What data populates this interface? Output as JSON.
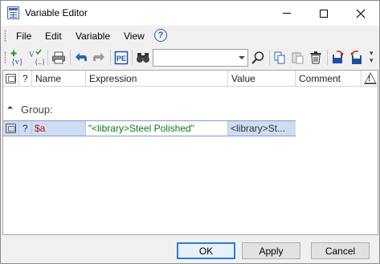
{
  "window": {
    "title": "Variable Editor"
  },
  "menu": {
    "items": [
      "File",
      "Edit",
      "Variable",
      "View"
    ]
  },
  "toolbar": {
    "search_value": "",
    "search_placeholder": ""
  },
  "grid": {
    "columns": {
      "q": "?",
      "name": "Name",
      "expression": "Expression",
      "value": "Value",
      "comment": "Comment"
    },
    "group_label": "Group:",
    "rows": [
      {
        "q": "?",
        "name": "$a",
        "expression": "\"<library>Steel Polished\"",
        "value": "<library>St...",
        "comment": ""
      }
    ]
  },
  "buttons": {
    "ok": "OK",
    "apply": "Apply",
    "cancel": "Cancel"
  },
  "colors": {
    "accent": "#2f7ad6",
    "selection": "#cfdcf2",
    "name_text": "#b01a1a",
    "expression_text": "#0a7a12"
  }
}
